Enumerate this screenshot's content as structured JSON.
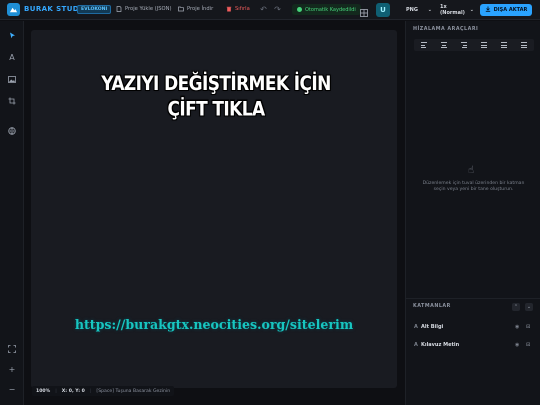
{
  "topbar": {
    "brand": "BURAK STUDIO",
    "edition": "EVLOKONI",
    "save_project": "Proje Yükle (JSON)",
    "download_project": "Proje İndir",
    "delete": "Sıfırla",
    "autosave": "Otomatik Kaydedildi",
    "magnet_label": "U",
    "format": "PNG",
    "scale": "1x (Normal)",
    "export": "DIŞA AKTAR"
  },
  "canvas": {
    "headline_line1": "YAZIYI DEĞİŞTİRMEK İÇİN",
    "headline_line2": "ÇİFT TIKLA",
    "url": "https://burakgtx.neocities.org/sitelerim"
  },
  "statusbar": {
    "zoom": "100%",
    "coords": "X: 0, Y: 0",
    "hint": "[Space] Tuşuna Basarak Gezinin"
  },
  "rightpanel": {
    "align_title": "HİZALAMA ARAÇLARI",
    "empty_text": "Düzenlemek için tuval üzerinden bir katman seçin veya yeni bir tane oluşturun.",
    "layers_title": "KATMANLAR",
    "layers": [
      {
        "type": "A",
        "name": "Alt Bilgi"
      },
      {
        "type": "A",
        "name": "Kılavuz Metin"
      }
    ]
  },
  "colors": {
    "accent": "#2aa3ff",
    "url_text": "#17c6c0",
    "autosave": "#46d27a",
    "delete": "#f05c5c"
  }
}
